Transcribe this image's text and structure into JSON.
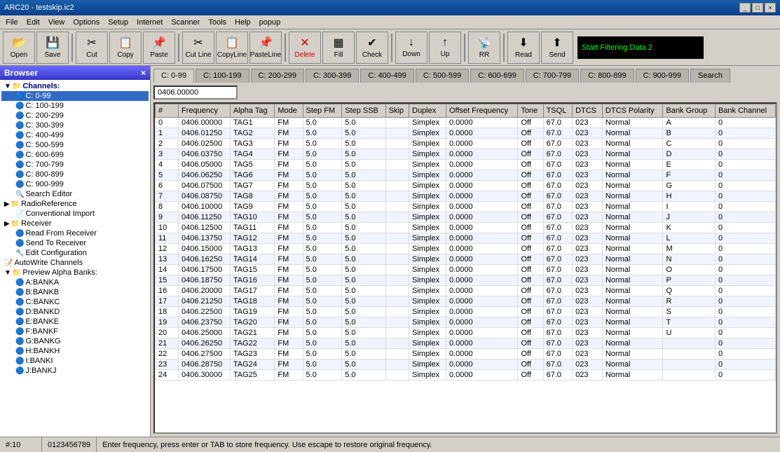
{
  "title": "ARC20 - testskip.ic2",
  "title_buttons": [
    "_",
    "□",
    "×"
  ],
  "menu": {
    "items": [
      "File",
      "Edit",
      "View",
      "Options",
      "Setup",
      "Internet",
      "Scanner",
      "Tools",
      "Help",
      "popup"
    ]
  },
  "toolbar": {
    "buttons": [
      {
        "label": "Open",
        "icon": "📂"
      },
      {
        "label": "Save",
        "icon": "💾"
      },
      {
        "label": "Cut",
        "icon": "✂"
      },
      {
        "label": "Copy",
        "icon": "📋"
      },
      {
        "label": "Paste",
        "icon": "📌"
      },
      {
        "label": "Cut Line",
        "icon": "✂"
      },
      {
        "label": "CopyLine",
        "icon": "📋"
      },
      {
        "label": "PasteLine",
        "icon": "📌"
      },
      {
        "label": "Delete",
        "icon": "✕"
      },
      {
        "label": "Fill",
        "icon": "▦"
      },
      {
        "label": "Check",
        "icon": "✔"
      },
      {
        "label": "Down",
        "icon": "↓"
      },
      {
        "label": "Up",
        "icon": "↑"
      },
      {
        "label": "RR",
        "icon": "📡"
      },
      {
        "label": "Read",
        "icon": "⬇"
      },
      {
        "label": "Send",
        "icon": "⬆"
      }
    ],
    "filter_text": "Start Filtering Data 2"
  },
  "browser": {
    "title": "Browser",
    "channels_label": "Channels:",
    "tree": [
      {
        "label": "C: 0-99",
        "indent": 1,
        "type": "channel",
        "selected": true
      },
      {
        "label": "C: 100-199",
        "indent": 1,
        "type": "channel"
      },
      {
        "label": "C: 200-299",
        "indent": 1,
        "type": "channel"
      },
      {
        "label": "C: 300-399",
        "indent": 1,
        "type": "channel"
      },
      {
        "label": "C: 400-499",
        "indent": 1,
        "type": "channel"
      },
      {
        "label": "C: 500-599",
        "indent": 1,
        "type": "channel"
      },
      {
        "label": "C: 600-699",
        "indent": 1,
        "type": "channel"
      },
      {
        "label": "C: 700-799",
        "indent": 1,
        "type": "channel"
      },
      {
        "label": "C: 800-899",
        "indent": 1,
        "type": "channel"
      },
      {
        "label": "C: 900-999",
        "indent": 1,
        "type": "channel"
      },
      {
        "label": "Search Editor",
        "indent": 1,
        "type": "search"
      },
      {
        "label": "RadioReference",
        "indent": 0,
        "type": "folder"
      },
      {
        "label": "Conventional Import",
        "indent": 1,
        "type": "item"
      },
      {
        "label": "Receiver",
        "indent": 0,
        "type": "folder"
      },
      {
        "label": "Read From Receiver",
        "indent": 1,
        "type": "item"
      },
      {
        "label": "Send To Receiver",
        "indent": 1,
        "type": "item"
      },
      {
        "label": "Edit Configuration",
        "indent": 1,
        "type": "item"
      },
      {
        "label": "AutoWrite Channels",
        "indent": 0,
        "type": "item"
      },
      {
        "label": "Preview Alpha Banks:",
        "indent": 0,
        "type": "folder"
      },
      {
        "label": "A:BANKA",
        "indent": 1,
        "type": "channel"
      },
      {
        "label": "B:BANKB",
        "indent": 1,
        "type": "channel"
      },
      {
        "label": "C:BANKC",
        "indent": 1,
        "type": "channel"
      },
      {
        "label": "D:BANKD",
        "indent": 1,
        "type": "channel"
      },
      {
        "label": "E:BANKE",
        "indent": 1,
        "type": "channel"
      },
      {
        "label": "F:BANKF",
        "indent": 1,
        "type": "channel"
      },
      {
        "label": "G:BANKG",
        "indent": 1,
        "type": "channel"
      },
      {
        "label": "H:BANKH",
        "indent": 1,
        "type": "channel"
      },
      {
        "label": "I:BANKI",
        "indent": 1,
        "type": "channel"
      },
      {
        "label": "J:BANKJ",
        "indent": 1,
        "type": "channel"
      }
    ]
  },
  "tabs": [
    "C: 0-99",
    "C: 100-199",
    "C: 200-299",
    "C: 300-399",
    "C: 400-499",
    "C: 500-599",
    "C: 600-699",
    "C: 700-799",
    "C: 800-899",
    "C: 900-999",
    "Search"
  ],
  "active_tab": 0,
  "frequency_input": "0406.00000",
  "table": {
    "headers": [
      "#",
      "Frequency",
      "Alpha Tag",
      "Mode",
      "Step FM",
      "Step SSB",
      "Skip",
      "Duplex",
      "Offset Frequency",
      "Tone",
      "TSQL",
      "DTCS",
      "DTCS Polarity",
      "Bank Group",
      "Bank Channel"
    ],
    "rows": [
      [
        0,
        "0406.00000",
        "TAG1",
        "FM",
        "5.0",
        "5.0",
        "",
        "Simplex",
        "0.0000",
        "Off",
        "67.0",
        "023",
        "Normal",
        "A",
        "0"
      ],
      [
        1,
        "0406.01250",
        "TAG2",
        "FM",
        "5.0",
        "5.0",
        "",
        "Simplex",
        "0.0000",
        "Off",
        "67.0",
        "023",
        "Normal",
        "B",
        "0"
      ],
      [
        2,
        "0406.02500",
        "TAG3",
        "FM",
        "5.0",
        "5.0",
        "",
        "Simplex",
        "0.0000",
        "Off",
        "67.0",
        "023",
        "Normal",
        "C",
        "0"
      ],
      [
        3,
        "0406.03750",
        "TAG4",
        "FM",
        "5.0",
        "5.0",
        "",
        "Simplex",
        "0.0000",
        "Off",
        "67.0",
        "023",
        "Normal",
        "D",
        "0"
      ],
      [
        4,
        "0406.05000",
        "TAG5",
        "FM",
        "5.0",
        "5.0",
        "",
        "Simplex",
        "0.0000",
        "Off",
        "67.0",
        "023",
        "Normal",
        "E",
        "0"
      ],
      [
        5,
        "0406.06250",
        "TAG6",
        "FM",
        "5.0",
        "5.0",
        "",
        "Simplex",
        "0.0000",
        "Off",
        "67.0",
        "023",
        "Normal",
        "F",
        "0"
      ],
      [
        6,
        "0406.07500",
        "TAG7",
        "FM",
        "5.0",
        "5.0",
        "",
        "Simplex",
        "0.0000",
        "Off",
        "67.0",
        "023",
        "Normal",
        "G",
        "0"
      ],
      [
        7,
        "0406.08750",
        "TAG8",
        "FM",
        "5.0",
        "5.0",
        "",
        "Simplex",
        "0.0000",
        "Off",
        "67.0",
        "023",
        "Normal",
        "H",
        "0"
      ],
      [
        8,
        "0406.10000",
        "TAG9",
        "FM",
        "5.0",
        "5.0",
        "",
        "Simplex",
        "0.0000",
        "Off",
        "67.0",
        "023",
        "Normal",
        "I",
        "0"
      ],
      [
        9,
        "0406.11250",
        "TAG10",
        "FM",
        "5.0",
        "5.0",
        "",
        "Simplex",
        "0.0000",
        "Off",
        "67.0",
        "023",
        "Normal",
        "J",
        "0"
      ],
      [
        10,
        "0406.12500",
        "TAG11",
        "FM",
        "5.0",
        "5.0",
        "",
        "Simplex",
        "0.0000",
        "Off",
        "67.0",
        "023",
        "Normal",
        "K",
        "0"
      ],
      [
        11,
        "0406.13750",
        "TAG12",
        "FM",
        "5.0",
        "5.0",
        "",
        "Simplex",
        "0.0000",
        "Off",
        "67.0",
        "023",
        "Normal",
        "L",
        "0"
      ],
      [
        12,
        "0406.15000",
        "TAG13",
        "FM",
        "5.0",
        "5.0",
        "",
        "Simplex",
        "0.0000",
        "Off",
        "67.0",
        "023",
        "Normal",
        "M",
        "0"
      ],
      [
        13,
        "0406.16250",
        "TAG14",
        "FM",
        "5.0",
        "5.0",
        "",
        "Simplex",
        "0.0000",
        "Off",
        "67.0",
        "023",
        "Normal",
        "N",
        "0"
      ],
      [
        14,
        "0406.17500",
        "TAG15",
        "FM",
        "5.0",
        "5.0",
        "",
        "Simplex",
        "0.0000",
        "Off",
        "67.0",
        "023",
        "Normal",
        "O",
        "0"
      ],
      [
        15,
        "0406.18750",
        "TAG16",
        "FM",
        "5.0",
        "5.0",
        "",
        "Simplex",
        "0.0000",
        "Off",
        "67.0",
        "023",
        "Normal",
        "P",
        "0"
      ],
      [
        16,
        "0406.20000",
        "TAG17",
        "FM",
        "5.0",
        "5.0",
        "",
        "Simplex",
        "0.0000",
        "Off",
        "67.0",
        "023",
        "Normal",
        "Q",
        "0"
      ],
      [
        17,
        "0406.21250",
        "TAG18",
        "FM",
        "5.0",
        "5.0",
        "",
        "Simplex",
        "0.0000",
        "Off",
        "67.0",
        "023",
        "Normal",
        "R",
        "0"
      ],
      [
        18,
        "0406.22500",
        "TAG19",
        "FM",
        "5.0",
        "5.0",
        "",
        "Simplex",
        "0.0000",
        "Off",
        "67.0",
        "023",
        "Normal",
        "S",
        "0"
      ],
      [
        19,
        "0406.23750",
        "TAG20",
        "FM",
        "5.0",
        "5.0",
        "",
        "Simplex",
        "0.0000",
        "Off",
        "67.0",
        "023",
        "Normal",
        "T",
        "0"
      ],
      [
        20,
        "0406.25000",
        "TAG21",
        "FM",
        "5.0",
        "5.0",
        "",
        "Simplex",
        "0.0000",
        "Off",
        "67.0",
        "023",
        "Normal",
        "U",
        "0"
      ],
      [
        21,
        "0406.26250",
        "TAG22",
        "FM",
        "5.0",
        "5.0",
        "",
        "Simplex",
        "0.0000",
        "Off",
        "67.0",
        "023",
        "Normal",
        "",
        "0"
      ],
      [
        22,
        "0406.27500",
        "TAG23",
        "FM",
        "5.0",
        "5.0",
        "",
        "Simplex",
        "0.0000",
        "Off",
        "67.0",
        "023",
        "Normal",
        "",
        "0"
      ],
      [
        23,
        "0406.28750",
        "TAG24",
        "FM",
        "5.0",
        "5.0",
        "",
        "Simplex",
        "0.0000",
        "Off",
        "67.0",
        "023",
        "Normal",
        "",
        "0"
      ],
      [
        24,
        "0406.30000",
        "TAG25",
        "FM",
        "5.0",
        "5.0",
        "",
        "Simplex",
        "0.0000",
        "Off",
        "67.0",
        "023",
        "Normal",
        "",
        "0"
      ]
    ]
  },
  "status": {
    "left": "#:10",
    "middle": "0123456789",
    "right": "Enter frequency, press enter or TAB to store frequency. Use escape to restore original frequency."
  }
}
